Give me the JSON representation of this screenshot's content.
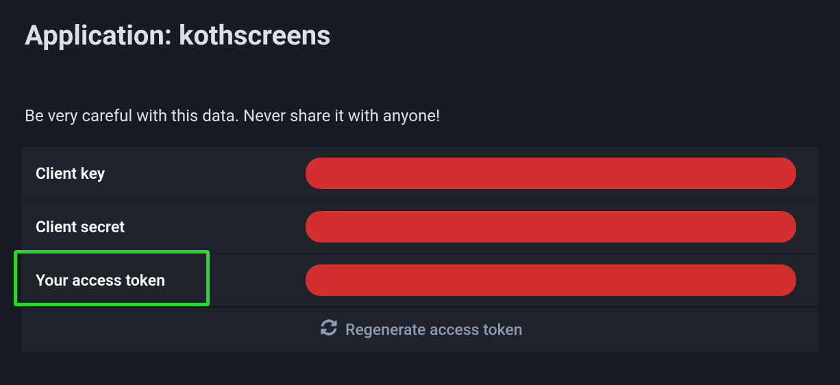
{
  "title": "Application: kothscreens",
  "warning": "Be very careful with this data. Never share it with anyone!",
  "rows": {
    "client_key": {
      "label": "Client key"
    },
    "client_secret": {
      "label": "Client secret"
    },
    "access_token": {
      "label": "Your access token"
    }
  },
  "regenerate_label": "Regenerate access token",
  "colors": {
    "redacted": "#d32f2f",
    "highlight": "#2bd72b"
  }
}
